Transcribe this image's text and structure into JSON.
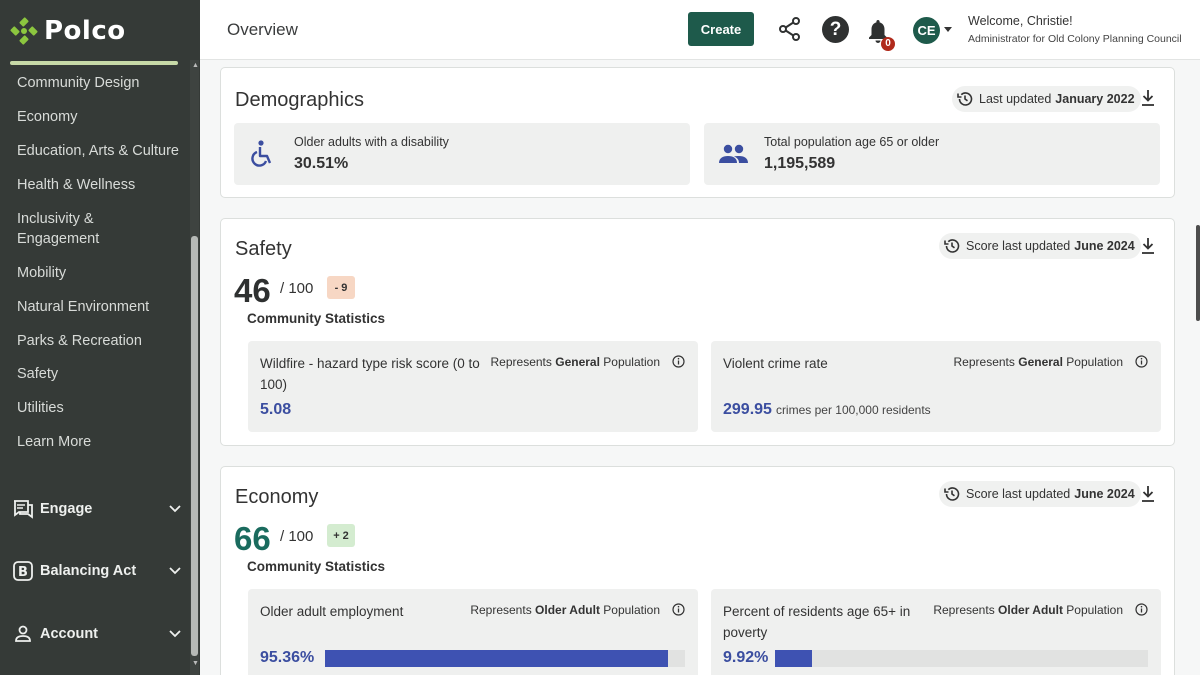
{
  "brand": {
    "name": "Polco",
    "accent": "#1e5a4b",
    "logo_green": "#8cc63f"
  },
  "sidebar": {
    "items": [
      {
        "label": "Community Design"
      },
      {
        "label": "Economy"
      },
      {
        "label": "Education, Arts & Culture"
      },
      {
        "label": "Health & Wellness"
      },
      {
        "label": "Inclusivity & Engagement"
      },
      {
        "label": "Mobility"
      },
      {
        "label": "Natural Environment"
      },
      {
        "label": "Parks & Recreation"
      },
      {
        "label": "Safety"
      },
      {
        "label": "Utilities"
      },
      {
        "label": "Learn More"
      }
    ],
    "groups": [
      {
        "label": "Engage",
        "icon": "chat-icon"
      },
      {
        "label": "Balancing Act",
        "icon": "balancing-act-icon"
      },
      {
        "label": "Account",
        "icon": "person-icon"
      }
    ]
  },
  "header": {
    "title": "Overview",
    "create_label": "Create",
    "help_label": "?",
    "notification_count": "0",
    "avatar_initials": "CE",
    "welcome": "Welcome, Christie!",
    "role": "Administrator for Old Colony Planning Council"
  },
  "demographics": {
    "title": "Demographics",
    "updated_prefix": "Last updated",
    "updated_date": "January 2022",
    "stats": [
      {
        "label": "Older adults with a disability",
        "value": "30.51%",
        "icon": "accessibility-icon"
      },
      {
        "label": "Total population age 65 or older",
        "value": "1,195,589",
        "icon": "people-icon"
      }
    ]
  },
  "safety": {
    "title": "Safety",
    "score": "46",
    "out_of": "/ 100",
    "delta": "- 9",
    "delta_color": "#f7d7c4",
    "updated_prefix": "Score last updated",
    "updated_date": "June 2024",
    "community_stats_title": "Community Statistics",
    "stats": [
      {
        "name": "Wildfire - hazard type risk score (0 to 100)",
        "rep_prefix": "Represents",
        "rep_group": "General",
        "rep_suffix": "Population",
        "value": "5.08",
        "unit": ""
      },
      {
        "name": "Violent crime rate",
        "rep_prefix": "Represents",
        "rep_group": "General",
        "rep_suffix": "Population",
        "value": "299.95",
        "unit": "crimes per 100,000 residents"
      }
    ]
  },
  "economy": {
    "title": "Economy",
    "score": "66",
    "out_of": "/ 100",
    "delta": "+ 2",
    "delta_color": "#d4ecd0",
    "updated_prefix": "Score last updated",
    "updated_date": "June 2024",
    "community_stats_title": "Community Statistics",
    "stats": [
      {
        "name": "Older adult employment",
        "rep_prefix": "Represents",
        "rep_group": "Older Adult",
        "rep_suffix": "Population",
        "value": "95.36%",
        "progress": 95.36
      },
      {
        "name": "Percent of residents age 65+ in poverty",
        "rep_prefix": "Represents",
        "rep_group": "Older Adult",
        "rep_suffix": "Population",
        "value": "9.92%",
        "progress": 9.92
      }
    ]
  },
  "colors": {
    "stat_value": "#3b4ea0",
    "bar_fill": "#3e52b2",
    "score_economy": "#1a6b5e",
    "sidebar_bg": "#353a37"
  }
}
